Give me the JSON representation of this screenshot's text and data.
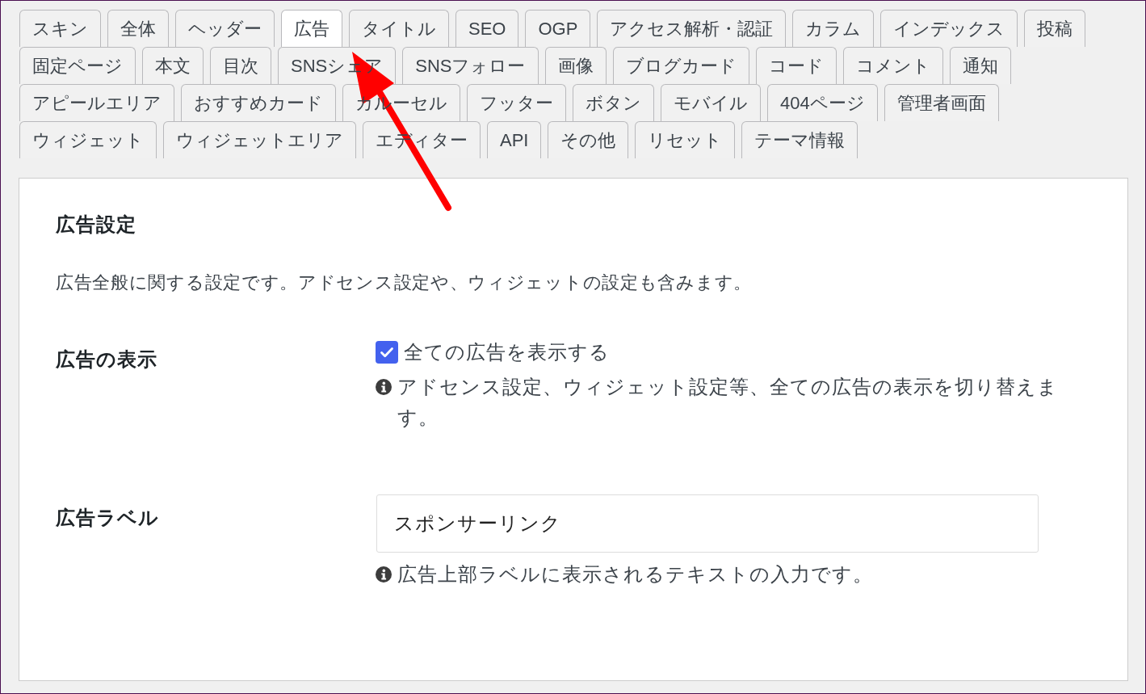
{
  "tab_rows": [
    {
      "tabs": [
        {
          "label": "スキン",
          "selected": false
        },
        {
          "label": "全体",
          "selected": false
        },
        {
          "label": "ヘッダー",
          "selected": false
        },
        {
          "label": "広告",
          "selected": true
        },
        {
          "label": "タイトル",
          "selected": false
        },
        {
          "label": "SEO",
          "selected": false
        },
        {
          "label": "OGP",
          "selected": false
        },
        {
          "label": "アクセス解析・認証",
          "selected": false
        },
        {
          "label": "カラム",
          "selected": false
        },
        {
          "label": "インデックス",
          "selected": false
        },
        {
          "label": "投稿",
          "selected": false
        }
      ]
    },
    {
      "tabs": [
        {
          "label": "固定ページ",
          "selected": false
        },
        {
          "label": "本文",
          "selected": false
        },
        {
          "label": "目次",
          "selected": false
        },
        {
          "label": "SNSシェア",
          "selected": false
        },
        {
          "label": "SNSフォロー",
          "selected": false
        },
        {
          "label": "画像",
          "selected": false
        },
        {
          "label": "ブログカード",
          "selected": false
        },
        {
          "label": "コード",
          "selected": false
        },
        {
          "label": "コメント",
          "selected": false
        },
        {
          "label": "通知",
          "selected": false
        }
      ]
    },
    {
      "tabs": [
        {
          "label": "アピールエリア",
          "selected": false
        },
        {
          "label": "おすすめカード",
          "selected": false
        },
        {
          "label": "カルーセル",
          "selected": false
        },
        {
          "label": "フッター",
          "selected": false
        },
        {
          "label": "ボタン",
          "selected": false
        },
        {
          "label": "モバイル",
          "selected": false
        },
        {
          "label": "404ページ",
          "selected": false
        },
        {
          "label": "管理者画面",
          "selected": false
        }
      ]
    },
    {
      "tabs": [
        {
          "label": "ウィジェット",
          "selected": false
        },
        {
          "label": "ウィジェットエリア",
          "selected": false
        },
        {
          "label": "エディター",
          "selected": false
        },
        {
          "label": "API",
          "selected": false
        },
        {
          "label": "その他",
          "selected": false
        },
        {
          "label": "リセット",
          "selected": false
        },
        {
          "label": "テーマ情報",
          "selected": false
        }
      ]
    }
  ],
  "panel": {
    "title": "広告設定",
    "description": "広告全般に関する設定です。アドセンス設定や、ウィジェットの設定も含みます。",
    "settings": [
      {
        "kind": "checkbox",
        "label": "広告の表示",
        "option": "全ての広告を表示する",
        "checked": true,
        "note": "アドセンス設定、ウィジェット設定等、全ての広告の表示を切り替えます。"
      },
      {
        "kind": "text",
        "label": "広告ラベル",
        "value": "スポンサーリンク",
        "note": "広告上部ラベルに表示されるテキストの入力です。"
      }
    ]
  }
}
